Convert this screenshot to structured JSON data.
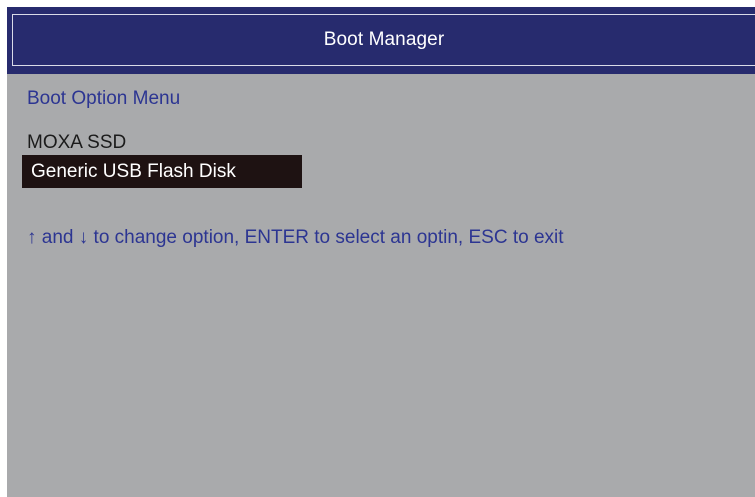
{
  "window": {
    "title": "Boot Manager"
  },
  "menu": {
    "heading": "Boot Option Menu",
    "options": [
      {
        "label": "MOXA SSD",
        "selected": false
      },
      {
        "label": "Generic USB Flash Disk",
        "selected": true
      }
    ]
  },
  "help": {
    "text": "↑  and ↓ to change option, ENTER to select an optin, ESC to exit"
  },
  "colors": {
    "background": "#a9aaac",
    "title_bar": "#272b6e",
    "heading_text": "#2c3592",
    "selected_bg": "#1e1212",
    "selected_text": "#ffffff"
  }
}
